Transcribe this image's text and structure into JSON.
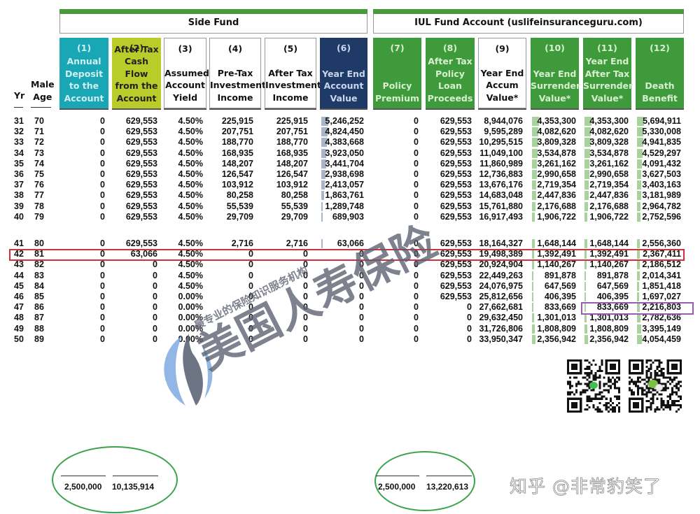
{
  "groups": {
    "side_fund": "Side Fund",
    "iul_fund": "IUL Fund Account (uslifeinsuranceguru.com)"
  },
  "side_headers": {
    "yr": "Yr",
    "age": "Male\nAge"
  },
  "columns": [
    {
      "num": "(1)",
      "label": "Annual\nDeposit\nto the\nAccount",
      "style": "teal"
    },
    {
      "num": "(2)",
      "label": "After Tax\nCash Flow\nfrom the\nAccount",
      "style": "lime"
    },
    {
      "num": "(3)",
      "label": "Assumed\nAccount\nYield",
      "style": "white"
    },
    {
      "num": "(4)",
      "label": "Pre-Tax\nInvestment\nIncome",
      "style": "white"
    },
    {
      "num": "(5)",
      "label": "After Tax\nInvestment\nIncome",
      "style": "white"
    },
    {
      "num": "(6)",
      "label": "Year End\nAccount\nValue",
      "style": "navy"
    },
    {
      "num": "(7)",
      "label": "Policy\nPremium",
      "style": "green"
    },
    {
      "num": "(8)",
      "label": "After Tax\nPolicy\nLoan\nProceeds",
      "style": "green"
    },
    {
      "num": "(9)",
      "label": "Year End\nAccum\nValue*",
      "style": "white"
    },
    {
      "num": "(10)",
      "label": "Year End\nSurrender\nValue*",
      "style": "green"
    },
    {
      "num": "(11)",
      "label": "Year End\nAfter Tax\nSurrender\nValue*",
      "style": "green"
    },
    {
      "num": "(12)",
      "label": "Death\nBenefit",
      "style": "green"
    }
  ],
  "rows": [
    [
      "31",
      "70",
      "0",
      "629,553",
      "4.50%",
      "225,915",
      "225,915",
      "5,246,252",
      "0",
      "629,553",
      "8,944,076",
      "4,353,300",
      "4,353,300",
      "5,694,911"
    ],
    [
      "32",
      "71",
      "0",
      "629,553",
      "4.50%",
      "207,751",
      "207,751",
      "4,824,450",
      "0",
      "629,553",
      "9,595,289",
      "4,082,620",
      "4,082,620",
      "5,330,008"
    ],
    [
      "33",
      "72",
      "0",
      "629,553",
      "4.50%",
      "188,770",
      "188,770",
      "4,383,668",
      "0",
      "629,553",
      "10,295,515",
      "3,809,328",
      "3,809,328",
      "4,941,835"
    ],
    [
      "34",
      "73",
      "0",
      "629,553",
      "4.50%",
      "168,935",
      "168,935",
      "3,923,050",
      "0",
      "629,553",
      "11,049,100",
      "3,534,878",
      "3,534,878",
      "4,529,297"
    ],
    [
      "35",
      "74",
      "0",
      "629,553",
      "4.50%",
      "148,207",
      "148,207",
      "3,441,704",
      "0",
      "629,553",
      "11,860,989",
      "3,261,162",
      "3,261,162",
      "4,091,432"
    ],
    [
      "36",
      "75",
      "0",
      "629,553",
      "4.50%",
      "126,547",
      "126,547",
      "2,938,698",
      "0",
      "629,553",
      "12,736,883",
      "2,990,658",
      "2,990,658",
      "3,627,503"
    ],
    [
      "37",
      "76",
      "0",
      "629,553",
      "4.50%",
      "103,912",
      "103,912",
      "2,413,057",
      "0",
      "629,553",
      "13,676,176",
      "2,719,354",
      "2,719,354",
      "3,403,163"
    ],
    [
      "38",
      "77",
      "0",
      "629,553",
      "4.50%",
      "80,258",
      "80,258",
      "1,863,761",
      "0",
      "629,553",
      "14,683,048",
      "2,447,836",
      "2,447,836",
      "3,181,989"
    ],
    [
      "39",
      "78",
      "0",
      "629,553",
      "4.50%",
      "55,539",
      "55,539",
      "1,289,748",
      "0",
      "629,553",
      "15,761,880",
      "2,176,688",
      "2,176,688",
      "2,964,782"
    ],
    [
      "40",
      "79",
      "0",
      "629,553",
      "4.50%",
      "29,709",
      "29,709",
      "689,903",
      "0",
      "629,553",
      "16,917,493",
      "1,906,722",
      "1,906,722",
      "2,752,596"
    ],
    [
      "41",
      "80",
      "0",
      "629,553",
      "4.50%",
      "2,716",
      "2,716",
      "63,066",
      "0",
      "629,553",
      "18,164,327",
      "1,648,144",
      "1,648,144",
      "2,556,360"
    ],
    [
      "42",
      "81",
      "0",
      "63,066",
      "4.50%",
      "0",
      "0",
      "0",
      "0",
      "629,553",
      "19,498,389",
      "1,392,491",
      "1,392,491",
      "2,367,411"
    ],
    [
      "43",
      "82",
      "0",
      "0",
      "4.50%",
      "0",
      "0",
      "0",
      "0",
      "629,553",
      "20,924,904",
      "1,140,267",
      "1,140,267",
      "2,186,512"
    ],
    [
      "44",
      "83",
      "0",
      "0",
      "4.50%",
      "0",
      "0",
      "0",
      "0",
      "629,553",
      "22,449,263",
      "891,878",
      "891,878",
      "2,014,341"
    ],
    [
      "45",
      "84",
      "0",
      "0",
      "4.50%",
      "0",
      "0",
      "0",
      "0",
      "629,553",
      "24,076,975",
      "647,569",
      "647,569",
      "1,851,418"
    ],
    [
      "46",
      "85",
      "0",
      "0",
      "0.00%",
      "0",
      "0",
      "0",
      "0",
      "629,553",
      "25,812,656",
      "406,395",
      "406,395",
      "1,697,027"
    ],
    [
      "47",
      "86",
      "0",
      "0",
      "0.00%",
      "0",
      "0",
      "0",
      "0",
      "0",
      "27,662,681",
      "833,669",
      "833,669",
      "2,216,803"
    ],
    [
      "48",
      "87",
      "0",
      "0",
      "0.00%",
      "0",
      "0",
      "0",
      "0",
      "0",
      "29,632,450",
      "1,301,013",
      "1,301,013",
      "2,782,636"
    ],
    [
      "49",
      "88",
      "0",
      "0",
      "0.00%",
      "0",
      "0",
      "0",
      "0",
      "0",
      "31,726,806",
      "1,808,809",
      "1,808,809",
      "3,395,149"
    ],
    [
      "50",
      "89",
      "0",
      "0",
      "0.00%",
      "0",
      "0",
      "0",
      "0",
      "0",
      "33,950,347",
      "2,356,942",
      "2,356,942",
      "4,054,459"
    ]
  ],
  "highlights": {
    "red_row_year": "42",
    "purple_row_year": "47",
    "red_color": "#d0313f",
    "purple_color": "#9a5bb5"
  },
  "totals": {
    "side_fund": {
      "deposit": "2,500,000",
      "cash_flow": "10,135,914"
    },
    "iul_fund": {
      "premium": "2,500,000",
      "loan_proceeds": "13,220,613"
    }
  },
  "watermark": {
    "main": "美国人寿保险",
    "sub": "最专业的保险知识服务机构",
    "credit": "知乎 @非常豹笑了"
  },
  "qr_codes": [
    {
      "name": "line-qr-code",
      "badge": "LINE"
    },
    {
      "name": "wechat-qr-code",
      "badge": "WeChat"
    }
  ],
  "colors": {
    "group_bar": "#4a9a3c",
    "teal": "#1aa7b5",
    "lime": "#b9cc2a",
    "navy": "#1f3a66",
    "green": "#3e9a3b",
    "oval": "#3aa34a"
  }
}
